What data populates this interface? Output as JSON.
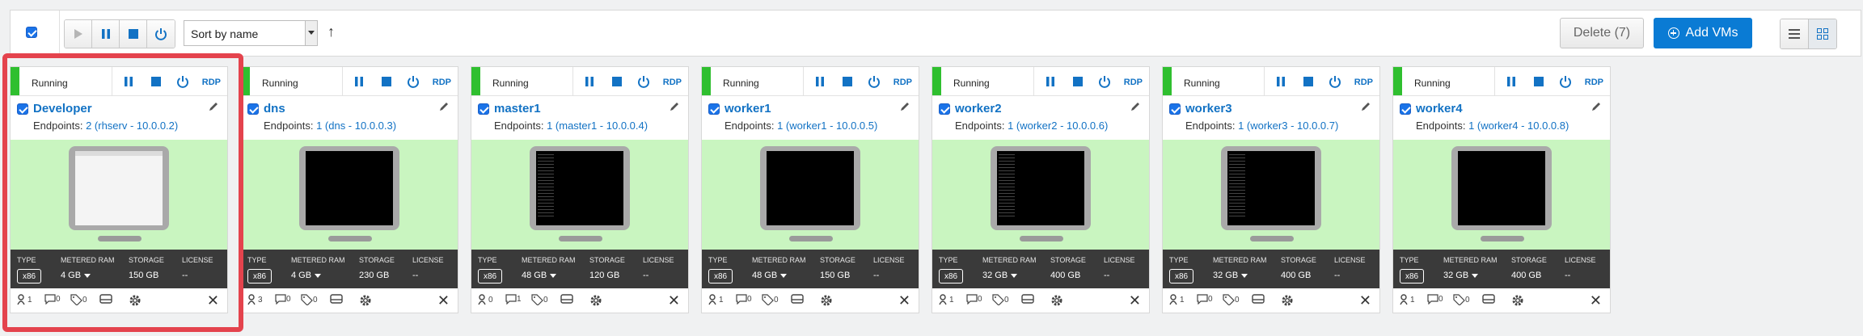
{
  "toolbar": {
    "sort_label": "Sort by name",
    "sort_direction": "↑",
    "delete_label": "Delete (7)",
    "add_label": "Add VMs"
  },
  "colors": {
    "accent": "#0a7bd4",
    "running": "#2fbf2f",
    "preview_bg": "#c9f5c0",
    "highlight": "#e4434d"
  },
  "labels": {
    "type": "TYPE",
    "ram": "METERED RAM",
    "storage": "STORAGE",
    "license": "LICENSE",
    "endpoints_prefix": "Endpoints:",
    "rdp": "RDP"
  },
  "vms": [
    {
      "status": "Running",
      "name": "Developer",
      "endpoints": "2 (rhserv - 10.0.0.2)",
      "type": "x86",
      "ram": "4 GB",
      "storage": "150 GB",
      "license": "--",
      "screen": "desktop",
      "users": "1",
      "comments": "0",
      "tags": "0"
    },
    {
      "status": "Running",
      "name": "dns",
      "endpoints": "1 (dns - 10.0.0.3)",
      "type": "x86",
      "ram": "4 GB",
      "storage": "230 GB",
      "license": "--",
      "screen": "black",
      "users": "3",
      "comments": "0",
      "tags": "0"
    },
    {
      "status": "Running",
      "name": "master1",
      "endpoints": "1 (master1 - 10.0.0.4)",
      "type": "x86",
      "ram": "48 GB",
      "storage": "120 GB",
      "license": "--",
      "screen": "console",
      "users": "0",
      "comments": "1",
      "tags": "0"
    },
    {
      "status": "Running",
      "name": "worker1",
      "endpoints": "1 (worker1 - 10.0.0.5)",
      "type": "x86",
      "ram": "48 GB",
      "storage": "150 GB",
      "license": "--",
      "screen": "black",
      "users": "1",
      "comments": "0",
      "tags": "0"
    },
    {
      "status": "Running",
      "name": "worker2",
      "endpoints": "1 (worker2 - 10.0.0.6)",
      "type": "x86",
      "ram": "32 GB",
      "storage": "400 GB",
      "license": "--",
      "screen": "console",
      "users": "1",
      "comments": "0",
      "tags": "0"
    },
    {
      "status": "Running",
      "name": "worker3",
      "endpoints": "1 (worker3 - 10.0.0.7)",
      "type": "x86",
      "ram": "32 GB",
      "storage": "400 GB",
      "license": "--",
      "screen": "console",
      "users": "1",
      "comments": "0",
      "tags": "0"
    },
    {
      "status": "Running",
      "name": "worker4",
      "endpoints": "1 (worker4 - 10.0.0.8)",
      "type": "x86",
      "ram": "32 GB",
      "storage": "400 GB",
      "license": "--",
      "screen": "black",
      "users": "1",
      "comments": "0",
      "tags": "0"
    }
  ]
}
